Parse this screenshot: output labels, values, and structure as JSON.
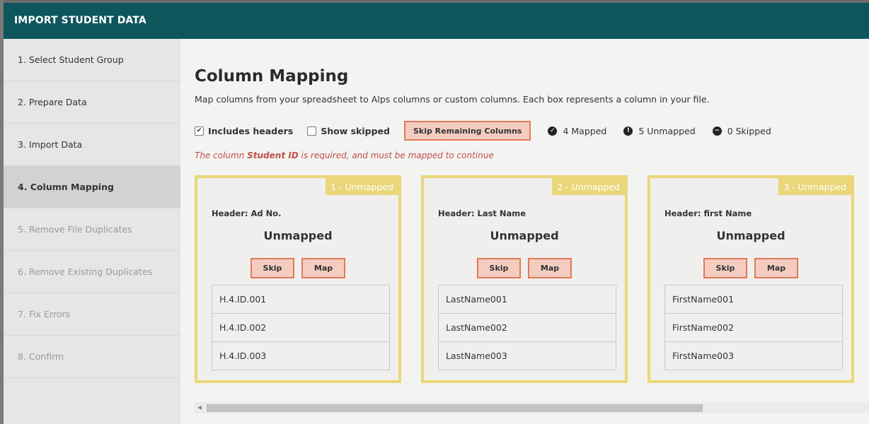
{
  "modal": {
    "title": "IMPORT STUDENT DATA"
  },
  "steps": [
    {
      "label": "1. Select Student Group",
      "state": "normal"
    },
    {
      "label": "2. Prepare Data",
      "state": "normal"
    },
    {
      "label": "3. Import Data",
      "state": "normal"
    },
    {
      "label": "4. Column Mapping",
      "state": "active"
    },
    {
      "label": "5. Remove File Duplicates",
      "state": "disabled"
    },
    {
      "label": "6. Remove Existing Duplicates",
      "state": "disabled"
    },
    {
      "label": "7. Fix Errors",
      "state": "disabled"
    },
    {
      "label": "8. Confirm",
      "state": "disabled"
    }
  ],
  "main": {
    "title": "Column Mapping",
    "description": "Map columns from your spreadsheet to Alps columns or custom columns. Each box represents a column in your file."
  },
  "toolbar": {
    "includes_headers_label": "Includes headers",
    "includes_headers_checked": true,
    "show_skipped_label": "Show skipped",
    "show_skipped_checked": false,
    "skip_remaining_label": "Skip Remaining Columns",
    "mapped_label": "4 Mapped",
    "unmapped_label": "5 Unmapped",
    "skipped_label": "0 Skipped"
  },
  "error": {
    "prefix": "The column ",
    "field": "Student ID",
    "suffix": " is required, and must be mapped to continue"
  },
  "cards": [
    {
      "badge": "1 - Unmapped",
      "header": "Header: Ad No.",
      "state": "Unmapped",
      "skip_label": "Skip",
      "map_label": "Map",
      "samples": [
        "H.4.ID.001",
        "H.4.ID.002",
        "H.4.ID.003"
      ]
    },
    {
      "badge": "2 - Unmapped",
      "header": "Header: Last Name",
      "state": "Unmapped",
      "skip_label": "Skip",
      "map_label": "Map",
      "samples": [
        "LastName001",
        "LastName002",
        "LastName003"
      ]
    },
    {
      "badge": "3 - Unmapped",
      "header": "Header: first Name",
      "state": "Unmapped",
      "skip_label": "Skip",
      "map_label": "Map",
      "samples": [
        "FirstName001",
        "FirstName002",
        "FirstName003"
      ]
    }
  ],
  "colors": {
    "header_bg": "#0e555c",
    "card_border": "#ead77a",
    "button_bg": "#f4cdc0",
    "button_border": "#e07a58",
    "error_text": "#c0504d"
  },
  "icons": {
    "mapped": "check-circle-icon",
    "unmapped": "exclamation-circle-icon",
    "skipped": "minus-circle-icon"
  }
}
